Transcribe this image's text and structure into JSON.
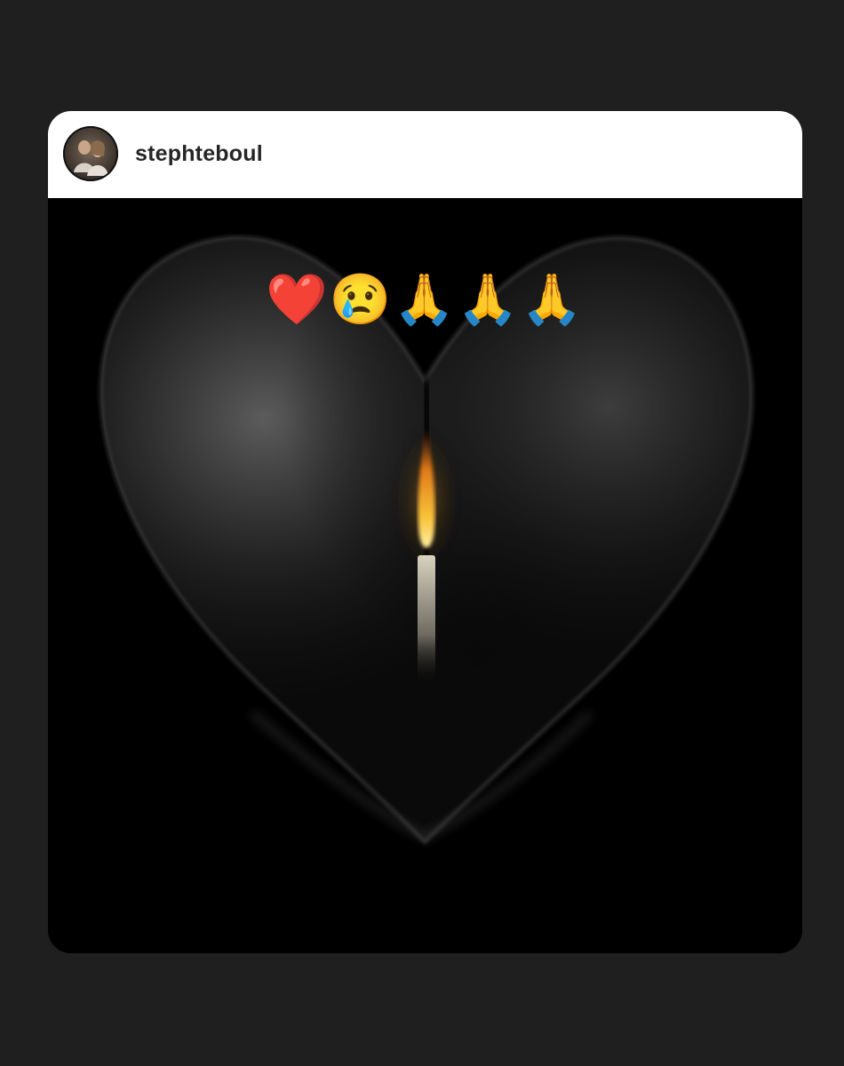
{
  "post": {
    "username": "stephteboul",
    "avatar_icon": "profile-photo",
    "image_caption_emojis": "❤️😢🙏🙏🙏",
    "image_icon": "black-heart-candle-image"
  },
  "colors": {
    "page_background": "#1f1f1f",
    "header_background": "#ffffff",
    "username_text": "#262626",
    "image_background": "#000000",
    "flame": "#f6a623"
  }
}
